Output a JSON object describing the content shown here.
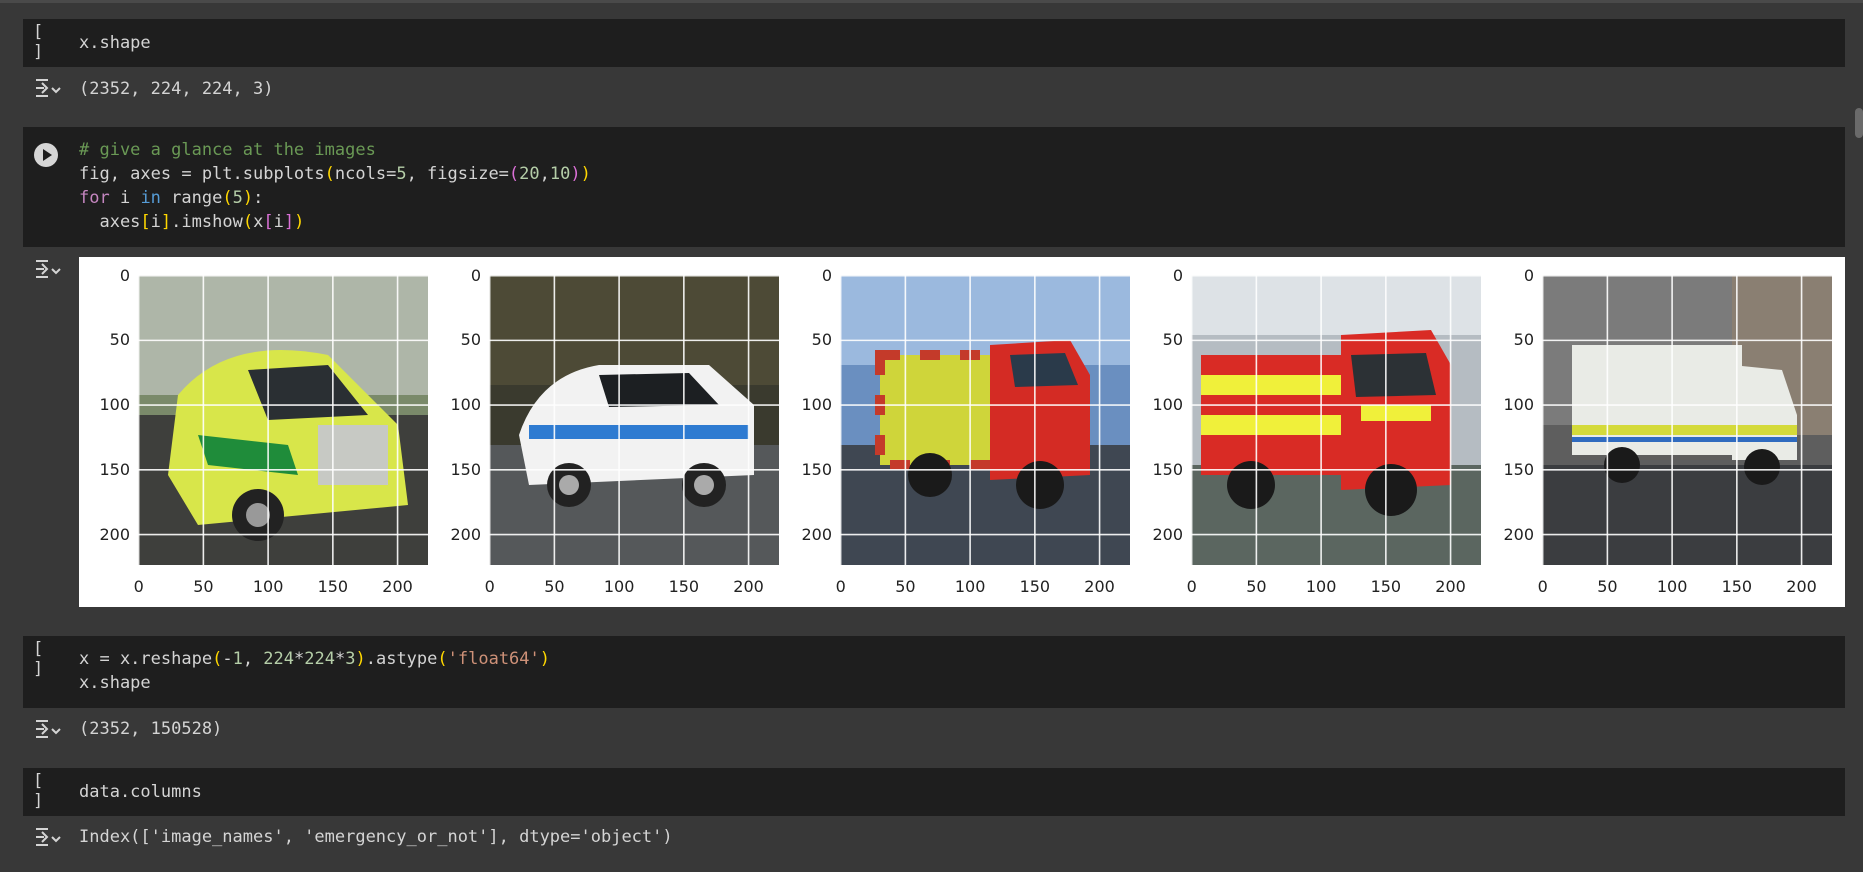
{
  "cells": {
    "c1": {
      "btn": "[ ]",
      "code": "x.shape",
      "output": "(2352, 224, 224, 3)"
    },
    "c2": {
      "comment": "# give a glance at the images",
      "output_icon": "output-collapse-icon"
    },
    "c3": {
      "btn": "[ ]",
      "output": "(2352, 150528)"
    },
    "c4": {
      "btn": "[ ]",
      "code": "data.columns",
      "output": "Index(['image_names', 'emergency_or_not'], dtype='object')"
    }
  },
  "figure": {
    "y_ticks": [
      "0",
      "50",
      "100",
      "150",
      "200"
    ],
    "x_ticks": [
      "0",
      "50",
      "100",
      "150",
      "200"
    ],
    "images": [
      "ambulance",
      "police-suv",
      "fire-truck",
      "fire-engine",
      "garda-van"
    ]
  },
  "colors": {
    "bg": "#383838",
    "cell": "#1e1e1e",
    "text": "#d4d4d4"
  }
}
